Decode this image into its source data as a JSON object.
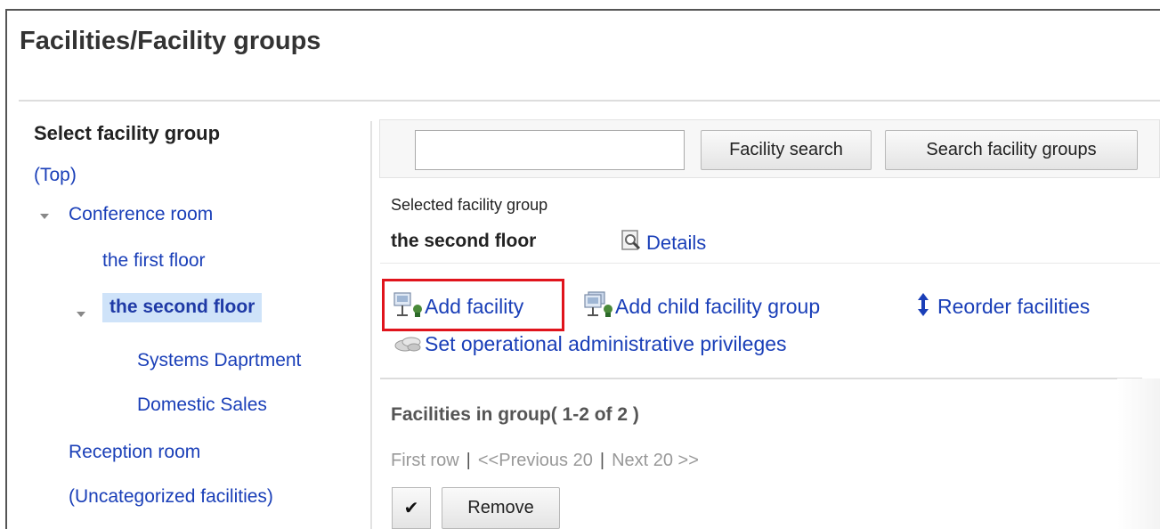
{
  "page": {
    "title": "Facilities/Facility groups"
  },
  "tree": {
    "header": "Select facility group",
    "items": [
      {
        "label": "(Top)"
      },
      {
        "label": "Conference room"
      },
      {
        "label": "the first floor"
      },
      {
        "label": "the second floor"
      },
      {
        "label": "Systems Daprtment"
      },
      {
        "label": "Domestic Sales"
      },
      {
        "label": "Reception room"
      },
      {
        "label": "(Uncategorized facilities)"
      }
    ]
  },
  "search": {
    "value": "",
    "placeholder": "",
    "facility_search_label": "Facility search",
    "group_search_label": "Search facility groups"
  },
  "selected": {
    "label": "Selected facility group",
    "name": "the second floor",
    "details_label": "Details"
  },
  "actions": {
    "add_facility": "Add facility",
    "add_child_group": "Add child facility group",
    "reorder": "Reorder facilities",
    "privileges": "Set operational administrative privileges"
  },
  "list": {
    "title": "Facilities in group( 1-2 of 2 )",
    "paging": {
      "first": "First row",
      "previous": "<<Previous 20",
      "next": "Next 20 >>",
      "separator": "|"
    },
    "check_symbol": "✔",
    "remove_label": "Remove"
  },
  "colors": {
    "link": "#1a3fb8",
    "selected_bg": "#cfe3f9",
    "highlight": "#e0141c"
  }
}
